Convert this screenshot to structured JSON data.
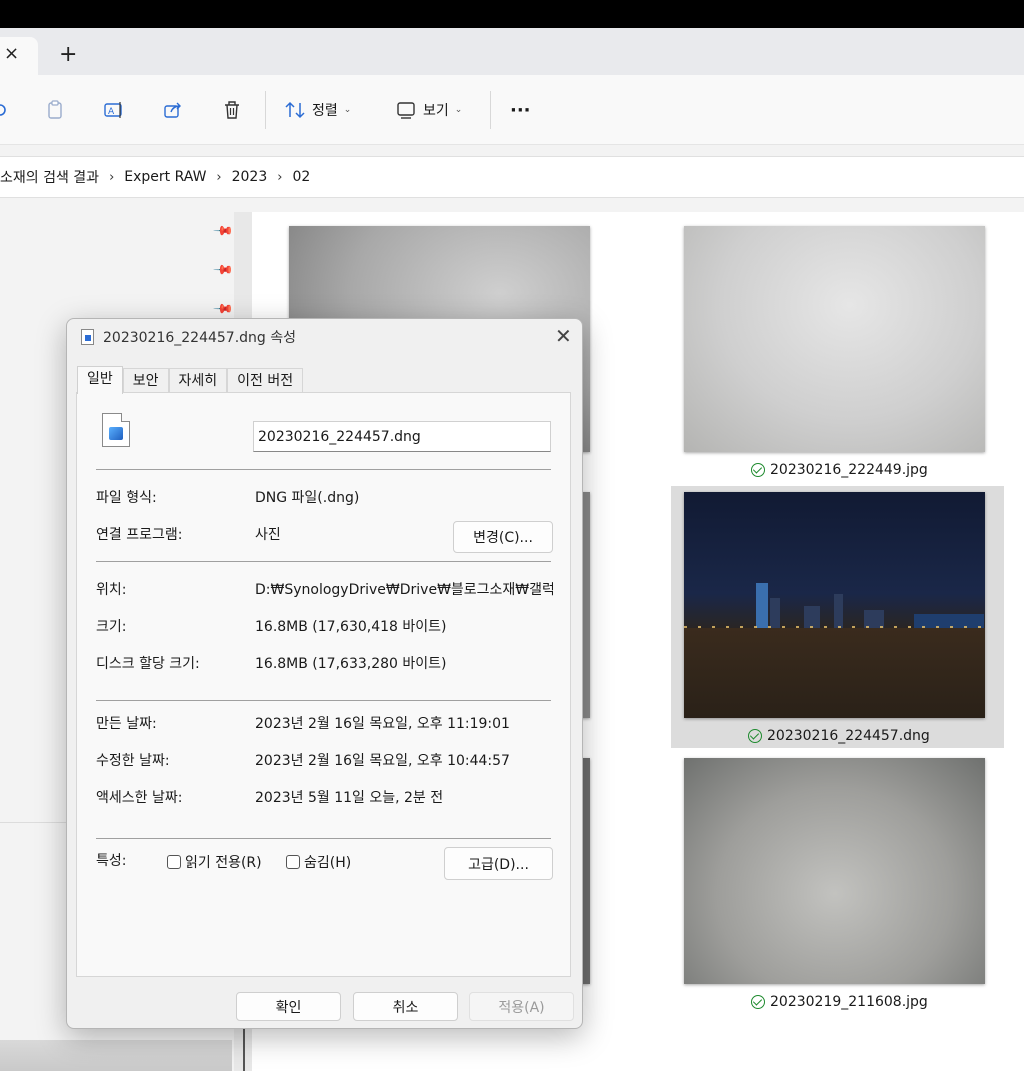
{
  "explorer": {
    "tab_close": "×",
    "new_tab": "+",
    "toolbar": {
      "sort_label": "정렬",
      "view_label": "보기",
      "more_label": "···"
    },
    "breadcrumb": [
      "소재의 검색 결과",
      "Expert RAW",
      "2023",
      "02"
    ],
    "files": [
      {
        "name": "20230216_222449.jpg"
      },
      {
        "name": "20230216_224457.dng"
      },
      {
        "name": "20230219_211608.jpg"
      }
    ]
  },
  "dialog": {
    "title": "20230216_224457.dng 속성",
    "tabs": [
      "일반",
      "보안",
      "자세히",
      "이전 버전"
    ],
    "file_name": "20230216_224457.dng",
    "rows": {
      "type_label": "파일 형식:",
      "type_value": "DNG 파일(.dng)",
      "opens_label": "연결 프로그램:",
      "opens_value": "사진",
      "change_button": "변경(C)...",
      "location_label": "위치:",
      "location_value": "D:₩SynologyDrive₩Drive₩블로그소재₩갤럭시",
      "size_label": "크기:",
      "size_value": "16.8MB (17,630,418 바이트)",
      "disk_label": "디스크 할당 크기:",
      "disk_value": "16.8MB (17,633,280 바이트)",
      "created_label": "만든 날짜:",
      "created_value": "2023년 2월 16일 목요일, 오후 11:19:01",
      "modified_label": "수정한 날짜:",
      "modified_value": "2023년 2월 16일 목요일, 오후 10:44:57",
      "accessed_label": "액세스한 날짜:",
      "accessed_value": "2023년 5월 11일 오늘, 2분 전",
      "attributes_label": "특성:",
      "readonly_label": "읽기 전용(R)",
      "hidden_label": "숨김(H)",
      "advanced_button": "고급(D)..."
    },
    "buttons": {
      "ok": "확인",
      "cancel": "취소",
      "apply": "적용(A)"
    }
  },
  "colors": {
    "accent": "#1e8a2e",
    "title_bar": "#000000"
  }
}
